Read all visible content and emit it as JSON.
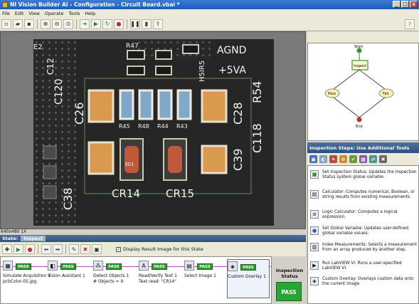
{
  "window": {
    "title": "NI Vision Builder AI - Configuration - Circuit Board.vbai *"
  },
  "menu": [
    "File",
    "Edit",
    "View",
    "Operate",
    "Tools",
    "Help"
  ],
  "image": {
    "size_label": "640x480 1X"
  },
  "board_labels": [
    "AGND",
    "+5VA",
    "C26",
    "C28",
    "R54",
    "C118",
    "C39",
    "C38",
    "CR14",
    "CR15",
    "C120",
    "R45",
    "R48",
    "R44",
    "R43",
    "R47",
    "H5IR5",
    "C12",
    "E2",
    "301"
  ],
  "state": {
    "label": "State:",
    "value": "Inspect"
  },
  "display_result": {
    "label": "Display Result Image for this State",
    "checked": true
  },
  "steps": [
    {
      "name": "Simulate Acquisition 1",
      "result": "pcbColor-05.jpg",
      "status": "PASS"
    },
    {
      "name": "Vision Assistant 1",
      "result": "",
      "status": "PASS"
    },
    {
      "name": "Detect Objects 1",
      "result": "# Objects = 9",
      "status": "PASS"
    },
    {
      "name": "Read/Verify Text 1",
      "result": "Text read: \"CR14\"",
      "status": "PASS"
    },
    {
      "name": "Select Image 1",
      "result": "",
      "status": "PASS"
    },
    {
      "name": "Custom Overlay 1",
      "result": "",
      "status": "PASS"
    }
  ],
  "inspection_status": {
    "label": "Inspection Status",
    "value": "PASS"
  },
  "flow": {
    "start": "Start",
    "inspect": "Inspect",
    "pass": "Pass",
    "fail": "Fail",
    "end": "End"
  },
  "steps_panel": {
    "title": "Inspection Steps: Use Additional Tools"
  },
  "tool_list": [
    {
      "text": "Set Inspection Status:  Updates the Inspection Status system global variable."
    },
    {
      "text": "Calculator:  Computes numerical, Boolean, or string results from existing measurements."
    },
    {
      "text": "Logic Calculator:  Computes a logical expression."
    },
    {
      "text": "Set Global Variable:  Updates user-defined global variable values."
    },
    {
      "text": "Index Measurements:  Selects a measurement from an array produced by another step."
    },
    {
      "text": "Run LabVIEW VI:  Runs a user-specified LabVIEW VI."
    },
    {
      "text": "Custom Overlay:  Overlays custom data onto the current image."
    }
  ],
  "colors": {
    "pass": "#27a535",
    "header": "#2f4f7f",
    "title": "#1f5cb8"
  }
}
